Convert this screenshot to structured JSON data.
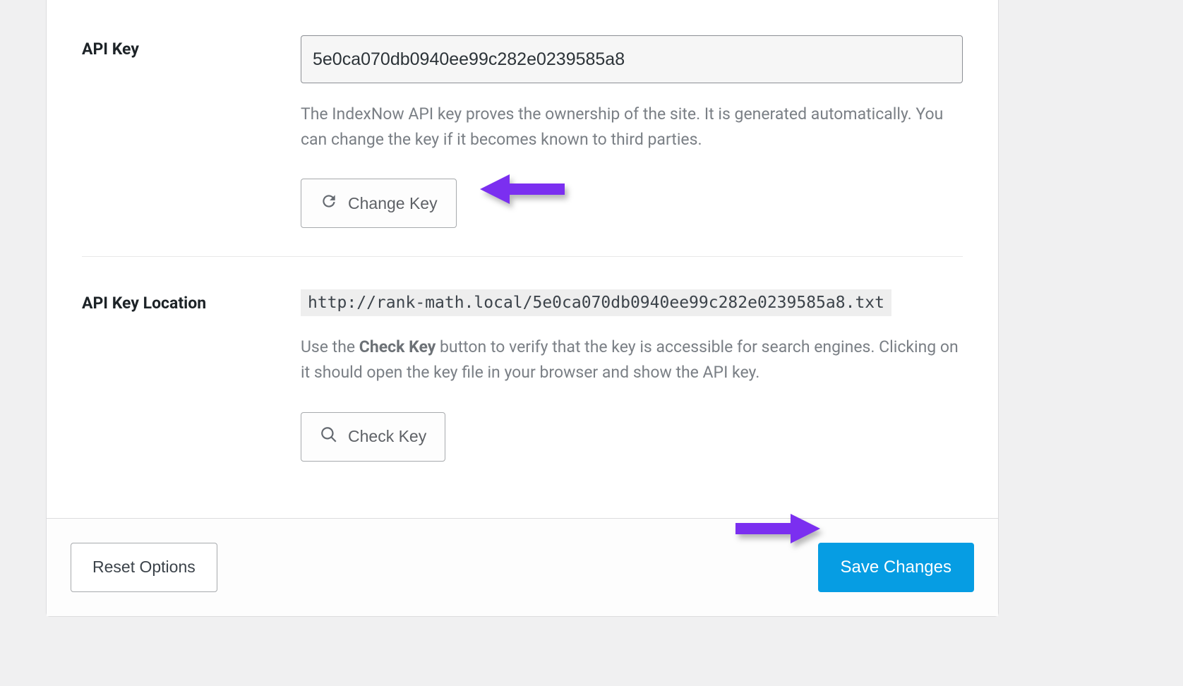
{
  "sections": {
    "api_key": {
      "label": "API Key",
      "value": "5e0ca070db0940ee99c282e0239585a8",
      "help": "The IndexNow API key proves the ownership of the site. It is generated automatically. You can change the key if it becomes known to third parties.",
      "change_button": "Change Key"
    },
    "api_key_location": {
      "label": "API Key Location",
      "url": "http://rank-math.local/5e0ca070db0940ee99c282e0239585a8.txt",
      "help_pre": "Use the ",
      "help_bold": "Check Key",
      "help_post": " button to verify that the key is accessible for search engines. Clicking on it should open the key file in your browser and show the API key.",
      "check_button": "Check Key"
    }
  },
  "footer": {
    "reset": "Reset Options",
    "save": "Save Changes"
  },
  "annotations": {
    "arrow1": "arrow-pointing-to-change-key",
    "arrow2": "arrow-pointing-to-save-changes"
  },
  "colors": {
    "primary": "#069de3",
    "arrow": "#7b2ff0"
  }
}
